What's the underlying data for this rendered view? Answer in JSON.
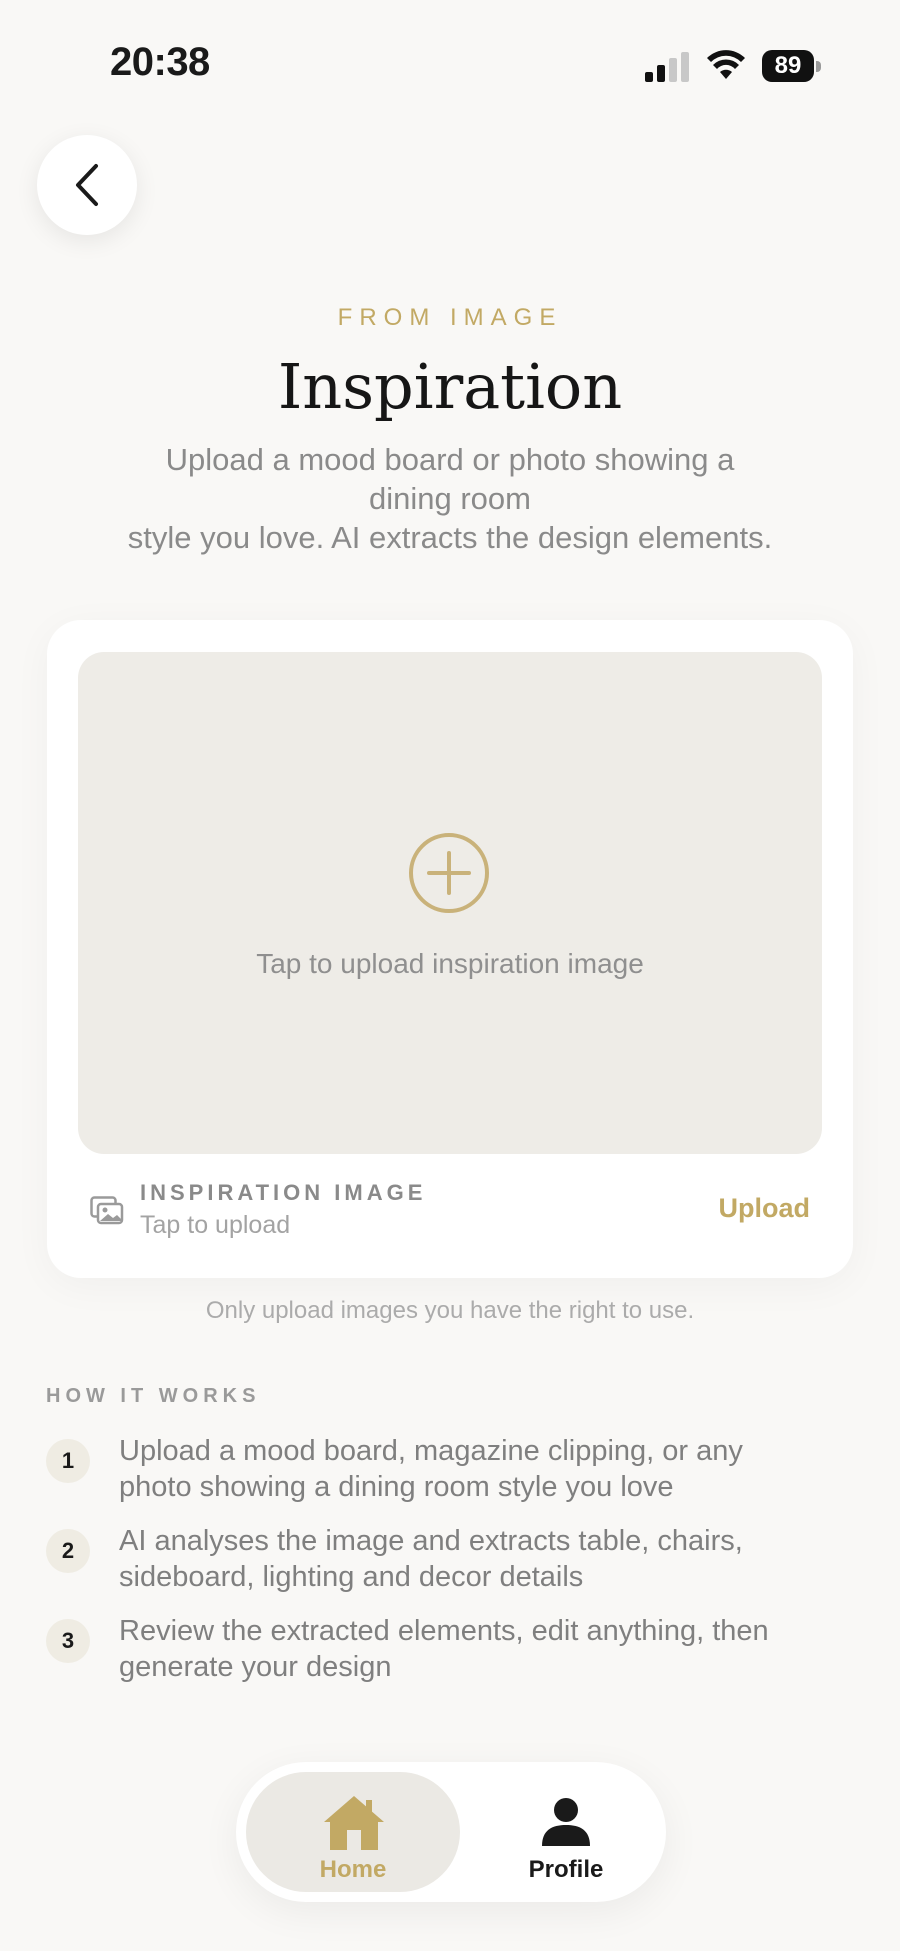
{
  "status_bar": {
    "time": "20:38",
    "battery": "89"
  },
  "header": {
    "eyebrow": "FROM IMAGE",
    "title": "Inspiration",
    "subtitle_line1": "Upload a mood board or photo showing a",
    "subtitle_line2": "dining room",
    "subtitle_line3": "style you love. AI extracts the design elements."
  },
  "upload_card": {
    "drop_text": "Tap to upload inspiration image",
    "label": "INSPIRATION IMAGE",
    "sublabel": "Tap to upload",
    "upload_button": "Upload"
  },
  "disclaimer": "Only upload images you have the right to use.",
  "how_it_works": {
    "title": "HOW IT WORKS",
    "steps": [
      {
        "num": "1",
        "line1": "Upload a mood board, magazine clipping, or any",
        "line2": "photo showing a dining room style you love"
      },
      {
        "num": "2",
        "line1": "AI analyses the image and extracts table, chairs,",
        "line2": "sideboard, lighting and decor details"
      },
      {
        "num": "3",
        "line1": "Review the extracted elements, edit anything, then",
        "line2": "generate your design"
      }
    ]
  },
  "nav": {
    "home": "Home",
    "profile": "Profile"
  },
  "colors": {
    "accent": "#c2a964",
    "background": "#f9f8f6",
    "drop_zone": "#eeece7"
  },
  "icons": [
    "back-chevron-icon",
    "plus-circle-icon",
    "image-icon",
    "home-icon",
    "person-icon",
    "signal-icon",
    "wifi-icon",
    "battery-icon"
  ]
}
